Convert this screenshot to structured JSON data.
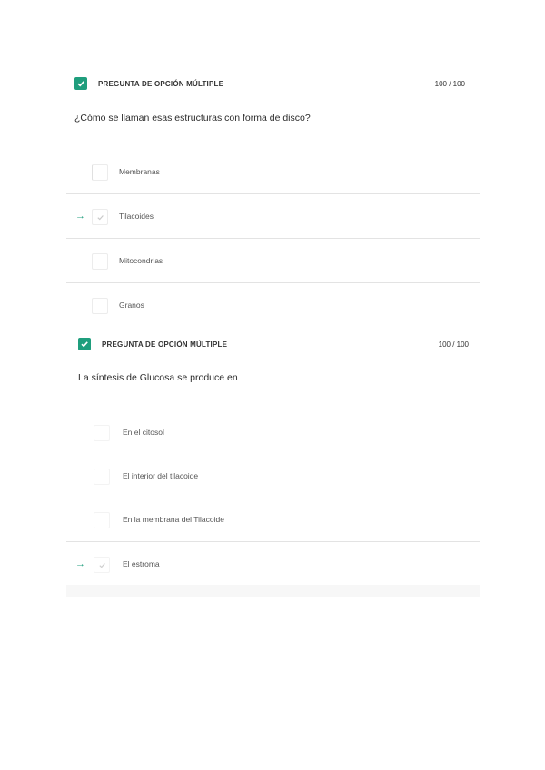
{
  "questions": [
    {
      "type_label": "PREGUNTA DE OPCIÓN MÚLTIPLE",
      "score": "100 / 100",
      "text": "¿Cómo se llaman esas estructuras con forma de disco?",
      "options": [
        {
          "label": "Membranas",
          "selected": false
        },
        {
          "label": "Tilacoides",
          "selected": true
        },
        {
          "label": "Mitocondrias",
          "selected": false
        },
        {
          "label": "Granos",
          "selected": false
        }
      ]
    },
    {
      "type_label": "PREGUNTA DE OPCIÓN MÚLTIPLE",
      "score": "100 / 100",
      "text": "La síntesis de Glucosa se produce en",
      "options": [
        {
          "label": "En el citosol",
          "selected": false
        },
        {
          "label": "El interior del tilacoide",
          "selected": false
        },
        {
          "label": "En la membrana del Tilacoide",
          "selected": false
        },
        {
          "label": "El estroma",
          "selected": true
        }
      ]
    }
  ],
  "icons": {
    "status": "checkmark-icon",
    "answer_marker": "arrow-right-icon",
    "option_check": "check-icon"
  },
  "colors": {
    "accent": "#1f9e7d",
    "divider": "#e3e3e3",
    "text": "#333333"
  }
}
